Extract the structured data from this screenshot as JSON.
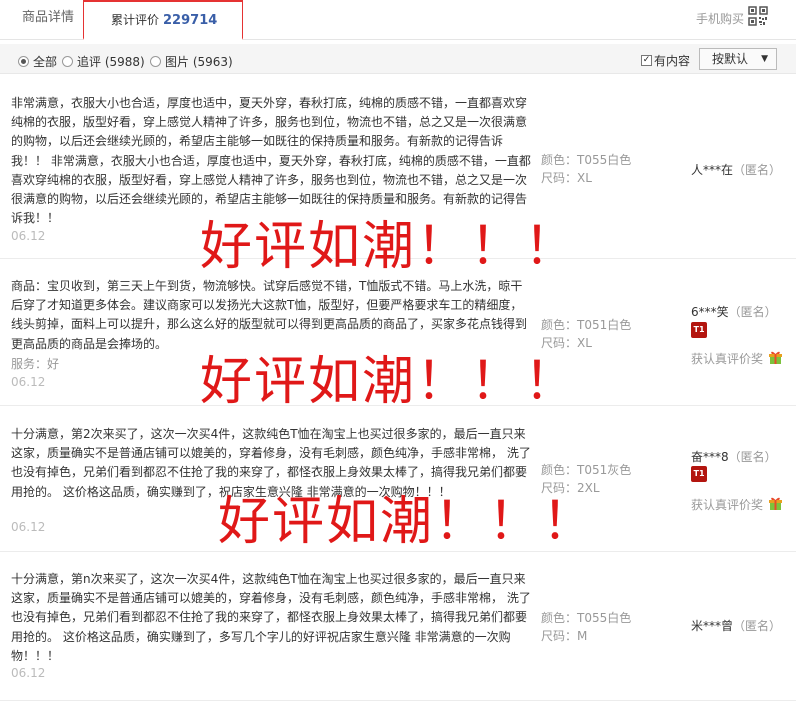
{
  "tabs": {
    "detail": "商品详情",
    "reviews_label": "累计评价",
    "reviews_count": "229714",
    "mobile_buy": "手机购买"
  },
  "filters": {
    "all": "全部",
    "append": "追评 (5988)",
    "images": "图片 (5963)",
    "has_content": "有内容",
    "sort": "按默认"
  },
  "reviews": [
    {
      "text": "非常满意，衣服大小也合适，厚度也适中，夏天外穿，春秋打底，纯棉的质感不错，一直都喜欢穿纯棉的衣服，版型好看，穿上感觉人精神了许多，服务也到位，物流也不错，总之又是一次很满意的购物，以后还会继续光顾的，希望店主能够一如既往的保持质量和服务。有新款的记得告诉我！！ 非常满意，衣服大小也合适，厚度也适中，夏天外穿，春秋打底，纯棉的质感不错，一直都喜欢穿纯棉的衣服，版型好看，穿上感觉人精神了许多，服务也到位，物流也不错，总之又是一次很满意的购物，以后还会继续光顾的，希望店主能够一如既往的保持质量和服务。有新款的记得告诉我！！",
      "date": "06.12",
      "color": "颜色：T055白色",
      "size": "尺码：XL",
      "user": "人***在",
      "anon": "（匿名）"
    },
    {
      "text": "商品：宝贝收到，第三天上午到货，物流够快。试穿后感觉不错，T恤版式不错。马上水洗，晾干后穿了才知道更多体会。建议商家可以发扬光大这款T恤，版型好，但要严格要求车工的精细度，线头剪掉，面料上可以提升，那么这么好的版型就可以得到更高品质的商品了，买家多花点钱得到更高品质的商品是会捧场的。",
      "service": "服务：好",
      "date": "06.12",
      "color": "颜色：T051白色",
      "size": "尺码：XL",
      "user": "6***笑",
      "anon": "（匿名）",
      "badge": "T1",
      "reward": "获认真评价奖"
    },
    {
      "text": "十分满意，第2次来买了，这次一次买4件，这款纯色T恤在淘宝上也买过很多家的，最后一直只来这家，质量确实不是普通店铺可以媲美的，穿着修身，没有毛刺感，颜色纯净，手感非常棉， 洗了也没有掉色，兄弟们看到都忍不住抢了我的来穿了，都怪衣服上身效果太棒了，搞得我兄弟们都要用抢的。 这价格这品质，确实赚到了，祝店家生意兴隆 非常满意的一次购物！！！",
      "date": "06.12",
      "color": "颜色：T051灰色",
      "size": "尺码：2XL",
      "user": "奋***8",
      "anon": "（匿名）",
      "badge": "T1",
      "reward": "获认真评价奖"
    },
    {
      "text": "十分满意，第n次来买了，这次一次买4件，这款纯色T恤在淘宝上也买过很多家的，最后一直只来这家，质量确实不是普通店铺可以媲美的，穿着修身，没有毛刺感，颜色纯净，手感非常棉， 洗了也没有掉色，兄弟们看到都忍不住抢了我的来穿了，都怪衣服上身效果太棒了，搞得我兄弟们都要用抢的。 这价格这品质，确实赚到了，多写几个字儿的好评祝店家生意兴隆 非常满意的一次购物！！！",
      "date": "06.12",
      "color": "颜色：T055白色",
      "size": "尺码：M",
      "user": "米***曾",
      "anon": "（匿名）"
    }
  ],
  "watermark": "好评如潮！！！"
}
